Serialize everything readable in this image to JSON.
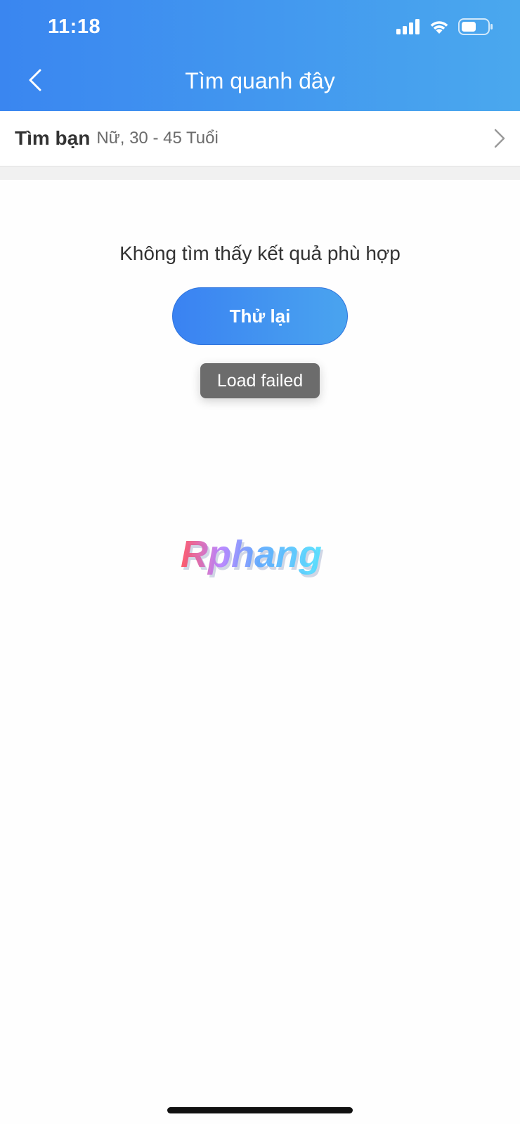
{
  "status_bar": {
    "time": "11:18",
    "icons": [
      "signal-icon",
      "wifi-icon",
      "battery-icon"
    ]
  },
  "header": {
    "title": "Tìm quanh đây",
    "back_icon": "chevron-left-icon",
    "gradient": [
      "#3a86f0",
      "#4aa8ee"
    ]
  },
  "filter": {
    "title": "Tìm bạn",
    "value": "Nữ, 30 - 45 Tuổi",
    "chevron_icon": "chevron-right-icon"
  },
  "empty_state": {
    "message": "Không tìm thấy kết quả phù hợp",
    "retry_label": "Thử lại"
  },
  "toast": {
    "message": "Load failed"
  },
  "watermark": {
    "text": "Rphang"
  },
  "colors": {
    "accent": "#3a86f0",
    "toast_bg": "#6c6c6c",
    "separator": "#f1f1f1"
  }
}
